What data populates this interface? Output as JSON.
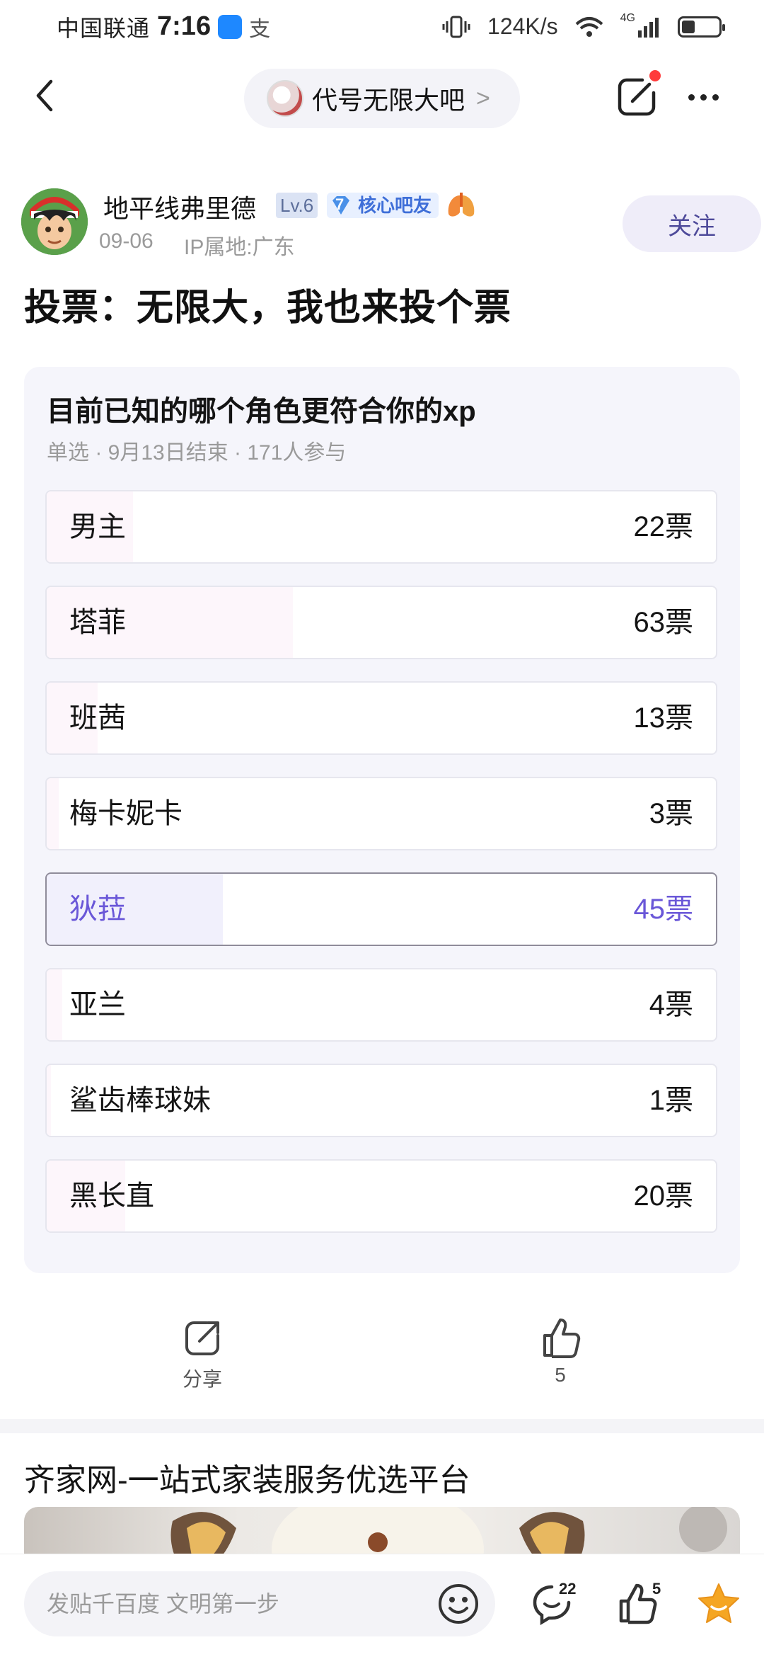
{
  "status_bar": {
    "carrier": "中国联通",
    "time": "7:16",
    "app_glyph": "支",
    "speed": "124K/s",
    "network": "4G"
  },
  "nav": {
    "forum_name": "代号无限大吧",
    "chevron": ">"
  },
  "author": {
    "name": "地平线弗里德",
    "level": "Lv.6",
    "core_level": "7",
    "core_badge": "核心吧友",
    "date": "09-06",
    "ip": "IP属地:广东",
    "follow_label": "关注"
  },
  "post": {
    "title": "投票：无限大，我也来投个票"
  },
  "vote": {
    "question": "目前已知的哪个角色更符合你的xp",
    "meta": "单选 · 9月13日结束 · 171人参与",
    "options": [
      {
        "label": "男主",
        "count": "22票",
        "votes": 22,
        "selected": false
      },
      {
        "label": "塔菲",
        "count": "63票",
        "votes": 63,
        "selected": false
      },
      {
        "label": "班茜",
        "count": "13票",
        "votes": 13,
        "selected": false
      },
      {
        "label": "梅卡妮卡",
        "count": "3票",
        "votes": 3,
        "selected": false
      },
      {
        "label": "狄菈",
        "count": "45票",
        "votes": 45,
        "selected": true
      },
      {
        "label": "亚兰",
        "count": "4票",
        "votes": 4,
        "selected": false
      },
      {
        "label": "鲨齿棒球妹",
        "count": "1票",
        "votes": 1,
        "selected": false
      },
      {
        "label": "黑长直",
        "count": "20票",
        "votes": 20,
        "selected": false
      }
    ]
  },
  "actions": {
    "share_label": "分享",
    "like_count": "5"
  },
  "ad": {
    "title": "齐家网-一站式家装服务优选平台"
  },
  "bottom_bar": {
    "comment_placeholder": "发贴千百度 文明第一步",
    "comment_count": "22",
    "like_count": "5"
  },
  "colors": {
    "accent": "#6a57d8",
    "follow_text": "#4e4a9a",
    "notification": "#ff3b3b",
    "favorite": "#f5a623"
  }
}
